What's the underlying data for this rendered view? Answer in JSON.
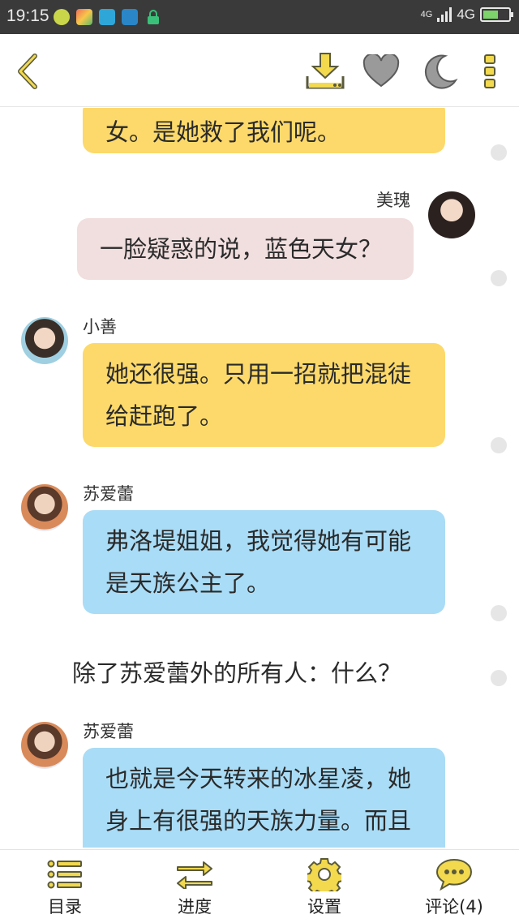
{
  "status_bar": {
    "time": "19:15",
    "network_small": "4G",
    "network": "4G",
    "battery_level": 0.6
  },
  "toolbar": {
    "back_icon": "chevron-left-icon",
    "download_icon": "download-icon",
    "favorite_icon": "heart-icon",
    "night_mode_icon": "moon-icon",
    "more_icon": "more-vertical-icon"
  },
  "messages": [
    {
      "type": "left",
      "speaker": "",
      "text_lines": [
        "女。是她救了我们呢。"
      ],
      "color": "#fcd96a"
    },
    {
      "type": "right",
      "speaker": "美瑰",
      "text_lines": [
        "一脸疑惑的说，蓝色天女？"
      ],
      "color": "#f1dede"
    },
    {
      "type": "left",
      "speaker": "小善",
      "text_lines": [
        "她还很强。只用一招就把混徒",
        "给赶跑了。"
      ],
      "color": "#fcd96a"
    },
    {
      "type": "left",
      "speaker": "苏爱蕾",
      "text_lines": [
        "弗洛堤姐姐，我觉得她有可能",
        "是天族公主了。"
      ],
      "color": "#a9dcf6"
    },
    {
      "type": "narration",
      "text_lines": [
        "除了苏爱蕾外的所有人：什么？"
      ]
    },
    {
      "type": "left",
      "speaker": "苏爱蕾",
      "text_lines": [
        "也就是今天转来的冰星凌，她",
        "身上有很强的天族力量。而且"
      ],
      "color": "#a9dcf6"
    }
  ],
  "bottom_nav": [
    {
      "label": "目录",
      "icon": "list-icon"
    },
    {
      "label": "进度",
      "icon": "swap-arrows-icon"
    },
    {
      "label": "设置",
      "icon": "gear-icon"
    },
    {
      "label": "评论(4)",
      "icon": "comment-icon"
    }
  ],
  "colors": {
    "accent": "#f2d94e",
    "icon_gray": "#9a9a9a",
    "yellow_bubble": "#fcd96a",
    "pink_bubble": "#f1dede",
    "blue_bubble": "#a9dcf6"
  }
}
